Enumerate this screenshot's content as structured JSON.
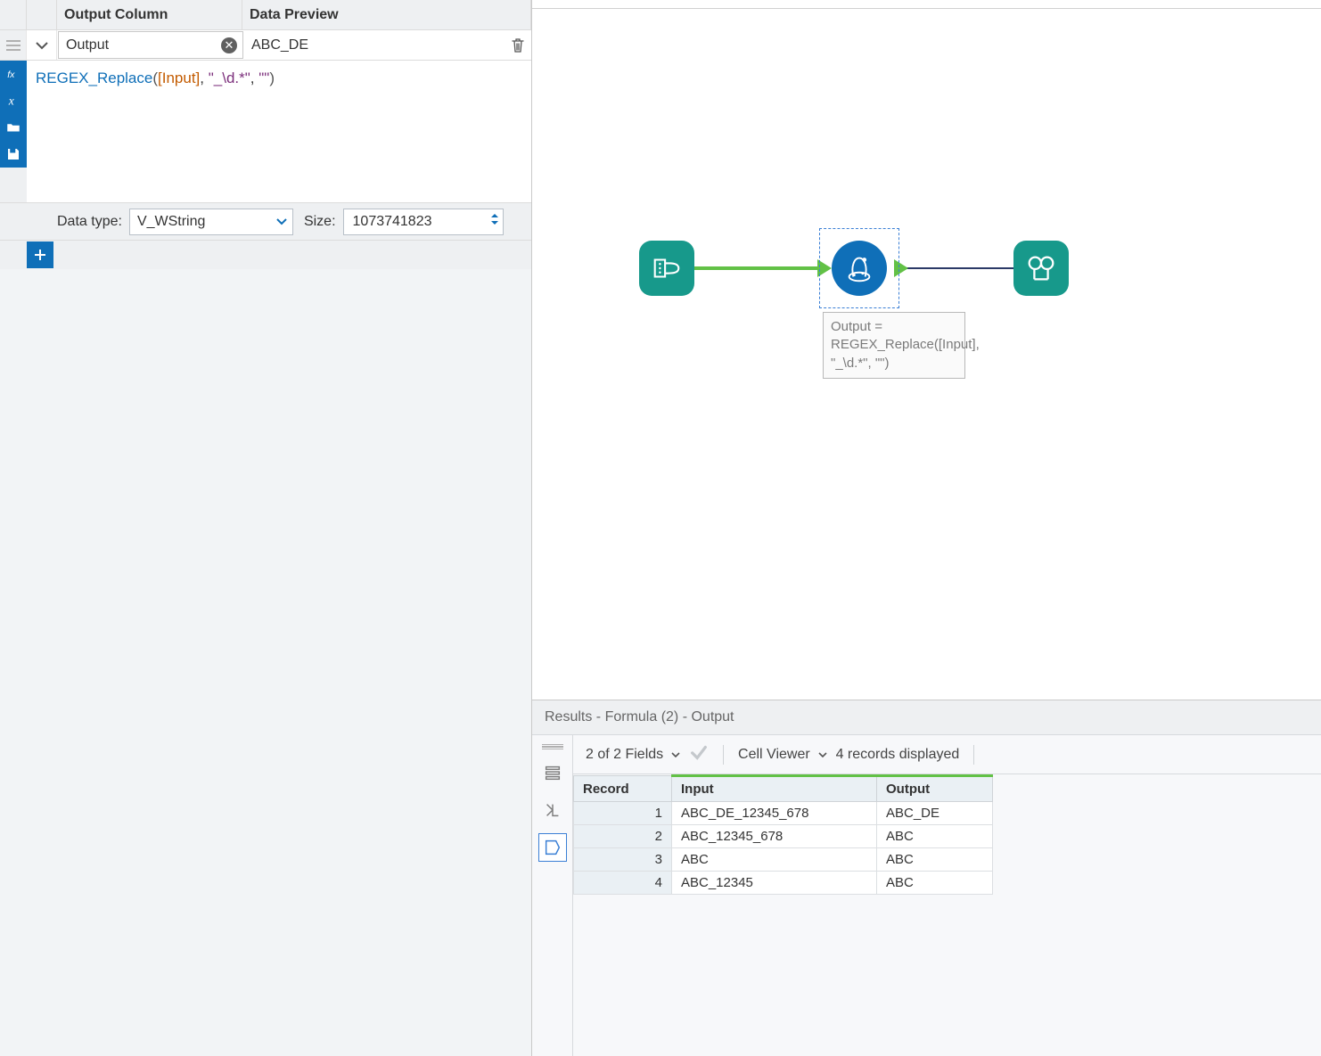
{
  "config": {
    "headers": {
      "output_column": "Output Column",
      "data_preview": "Data Preview"
    },
    "output_field_value": "Output",
    "preview_value": "ABC_DE",
    "expression": {
      "func": "REGEX_Replace",
      "field": "[Input]",
      "arg1": "\"_\\d.*\"",
      "arg2": "\"\""
    },
    "data_type_label": "Data type:",
    "data_type_value": "V_WString",
    "size_label": "Size:",
    "size_value": "1073741823"
  },
  "canvas": {
    "annotation": "Output = REGEX_Replace([Input], \"_\\d.*\", \"\")"
  },
  "results": {
    "title": "Results - Formula (2) - Output",
    "fields_text": "2 of 2 Fields",
    "cell_viewer_label": "Cell Viewer",
    "records_text": "4 records displayed",
    "columns": {
      "record": "Record",
      "input": "Input",
      "output": "Output"
    },
    "rows": [
      {
        "n": "1",
        "input": "ABC_DE_12345_678",
        "output": "ABC_DE"
      },
      {
        "n": "2",
        "input": "ABC_12345_678",
        "output": "ABC"
      },
      {
        "n": "3",
        "input": "ABC",
        "output": "ABC"
      },
      {
        "n": "4",
        "input": "ABC_12345",
        "output": "ABC"
      }
    ]
  }
}
